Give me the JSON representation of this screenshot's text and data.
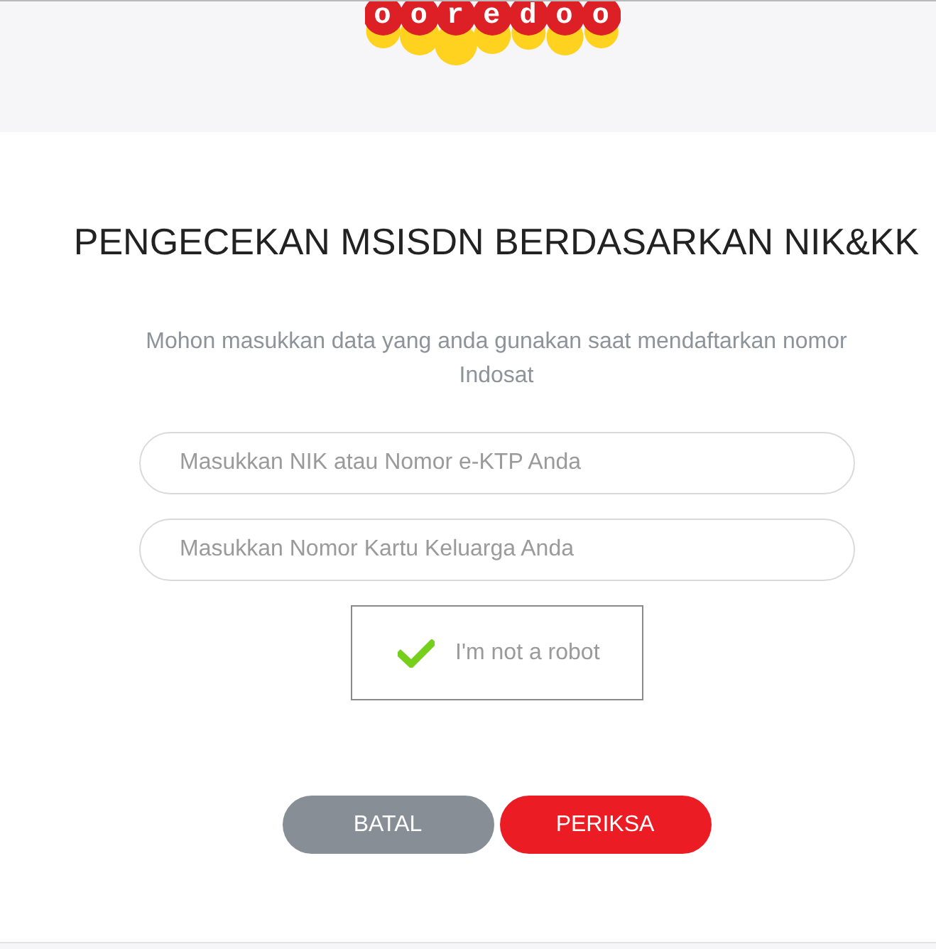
{
  "header": {
    "logo": {
      "text": "ooredoo"
    }
  },
  "form": {
    "title": "PENGECEKAN MSISDN BERDASARKAN NIK&KK",
    "subtitle": "Mohon masukkan data yang anda gunakan saat mendaftarkan nomor Indosat",
    "fields": [
      {
        "placeholder": "Masukkan NIK atau Nomor e-KTP Anda"
      },
      {
        "placeholder": "Masukkan Nomor Kartu Keluarga Anda"
      }
    ],
    "captcha": {
      "label": "I'm not a robot",
      "checked": true
    },
    "buttons": [
      {
        "label": "BATAL",
        "kind": "cancel"
      },
      {
        "label": "PERIKSA",
        "kind": "submit"
      }
    ]
  }
}
